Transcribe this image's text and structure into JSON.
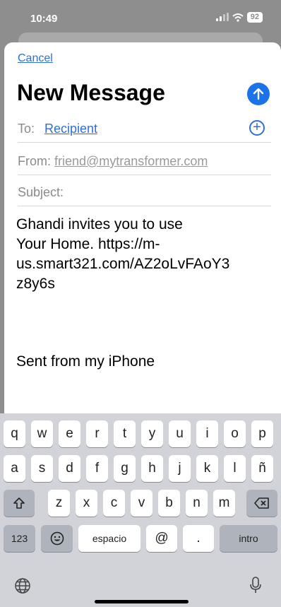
{
  "status": {
    "time": "10:49",
    "battery": "92"
  },
  "compose": {
    "cancel": "Cancel",
    "title": "New Message",
    "to_label": "To:",
    "to_value": "Recipient",
    "from_label": "From:",
    "from_value": "friend@mytransformer.com",
    "subject_label": "Subject:",
    "body": "Ghandi invites you to use\nYour Home. https://m-\nus.smart321.com/AZ2oLvFAoY3\nz8y6s",
    "signature": "Sent from my iPhone"
  },
  "keyboard": {
    "row1": [
      "q",
      "w",
      "e",
      "r",
      "t",
      "y",
      "u",
      "i",
      "o",
      "p"
    ],
    "row2": [
      "a",
      "s",
      "d",
      "f",
      "g",
      "h",
      "j",
      "k",
      "l",
      "ñ"
    ],
    "row3": [
      "z",
      "x",
      "c",
      "v",
      "b",
      "n",
      "m"
    ],
    "numbers": "123",
    "space": "espacio",
    "at": "@",
    "dot": ".",
    "return": "intro"
  },
  "colors": {
    "accent": "#2f6fd9",
    "send": "#1a73e8"
  }
}
